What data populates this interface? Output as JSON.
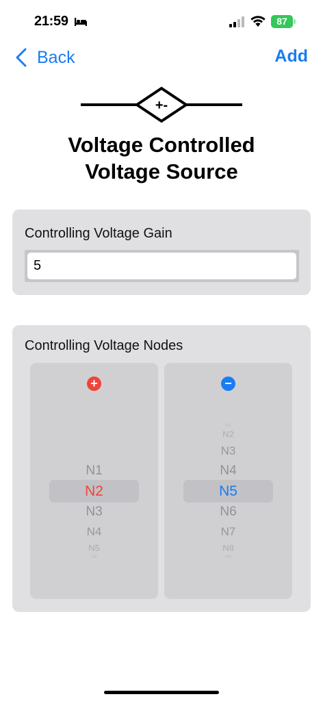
{
  "status_bar": {
    "time": "21:59",
    "battery_level": "87"
  },
  "nav": {
    "back_label": "Back",
    "add_label": "Add"
  },
  "component": {
    "symbol_mark": "+-",
    "title_line1": "Voltage Controlled",
    "title_line2": "Voltage Source"
  },
  "gain": {
    "label": "Controlling Voltage Gain",
    "value": "5"
  },
  "nodes": {
    "label": "Controlling Voltage Nodes",
    "positive": {
      "badge": "+",
      "items": [
        "N1",
        "N2",
        "N3",
        "N4",
        "N5",
        "N6"
      ],
      "selected": "N2"
    },
    "negative": {
      "badge": "−",
      "items": [
        "N1",
        "N2",
        "N3",
        "N4",
        "N5",
        "N6",
        "N7",
        "N8",
        "N9"
      ],
      "selected": "N5"
    }
  },
  "colors": {
    "accent_blue": "#1a7cf2",
    "accent_red": "#f0443a",
    "battery_green": "#34c759"
  }
}
